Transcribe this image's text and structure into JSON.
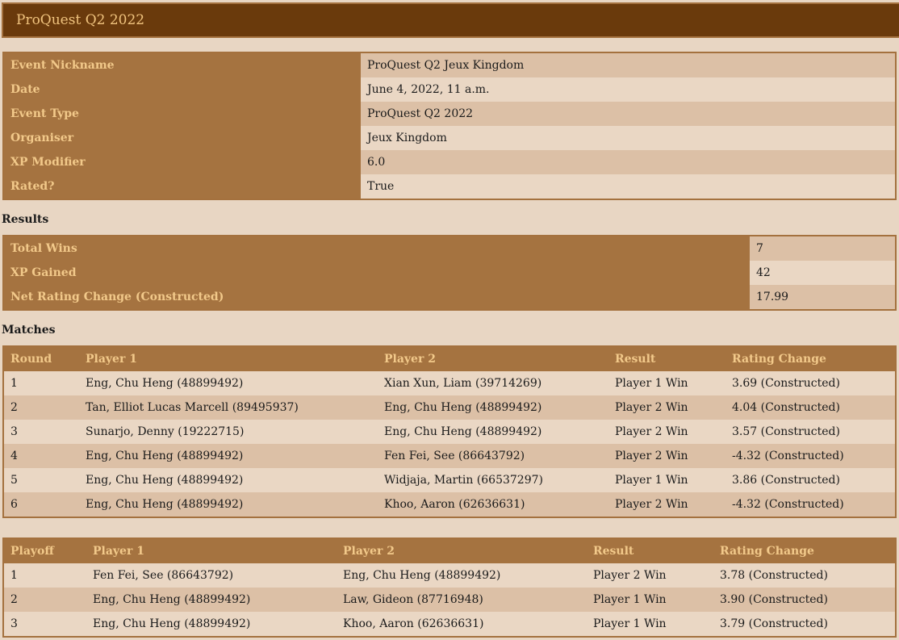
{
  "page": {
    "title": "ProQuest Q2 2022"
  },
  "event_info": [
    {
      "label": "Event Nickname",
      "value": "ProQuest Q2 Jeux Kingdom"
    },
    {
      "label": "Date",
      "value": "June 4, 2022, 11 a.m."
    },
    {
      "label": "Event Type",
      "value": "ProQuest Q2 2022"
    },
    {
      "label": "Organiser",
      "value": "Jeux Kingdom"
    },
    {
      "label": "XP Modifier",
      "value": "6.0"
    },
    {
      "label": "Rated?",
      "value": "True"
    }
  ],
  "results": {
    "heading": "Results",
    "rows": [
      {
        "label": "Total Wins",
        "value": "7"
      },
      {
        "label": "XP Gained",
        "value": "42"
      },
      {
        "label": "Net Rating Change (Constructed)",
        "value": "17.99"
      }
    ]
  },
  "matches": {
    "heading": "Matches",
    "columns": [
      "Round",
      "Player 1",
      "Player 2",
      "Result",
      "Rating Change"
    ],
    "rows": [
      [
        "1",
        "Eng, Chu Heng (48899492)",
        "Xian Xun, Liam (39714269)",
        "Player 1 Win",
        "3.69 (Constructed)"
      ],
      [
        "2",
        "Tan, Elliot Lucas Marcell (89495937)",
        "Eng, Chu Heng (48899492)",
        "Player 2 Win",
        "4.04 (Constructed)"
      ],
      [
        "3",
        "Sunarjo, Denny (19222715)",
        "Eng, Chu Heng (48899492)",
        "Player 2 Win",
        "3.57 (Constructed)"
      ],
      [
        "4",
        "Eng, Chu Heng (48899492)",
        "Fen Fei, See (86643792)",
        "Player 2 Win",
        "-4.32 (Constructed)"
      ],
      [
        "5",
        "Eng, Chu Heng (48899492)",
        "Widjaja, Martin (66537297)",
        "Player 1 Win",
        "3.86 (Constructed)"
      ],
      [
        "6",
        "Eng, Chu Heng (48899492)",
        "Khoo, Aaron (62636631)",
        "Player 2 Win",
        "-4.32 (Constructed)"
      ]
    ]
  },
  "playoffs": {
    "columns": [
      "Playoff",
      "Player 1",
      "Player 2",
      "Result",
      "Rating Change"
    ],
    "rows": [
      [
        "1",
        "Fen Fei, See (86643792)",
        "Eng, Chu Heng (48899492)",
        "Player 2 Win",
        "3.78 (Constructed)"
      ],
      [
        "2",
        "Eng, Chu Heng (48899492)",
        "Law, Gideon (87716948)",
        "Player 1 Win",
        "3.90 (Constructed)"
      ],
      [
        "3",
        "Eng, Chu Heng (48899492)",
        "Khoo, Aaron (62636631)",
        "Player 1 Win",
        "3.79 (Constructed)"
      ]
    ]
  },
  "colors": {
    "header_bg": "#6a3a0c",
    "label_bg": "#a57340",
    "label_text": "#f2c98a",
    "row_dark": "#dcc0a6",
    "row_light": "#ead7c4"
  }
}
